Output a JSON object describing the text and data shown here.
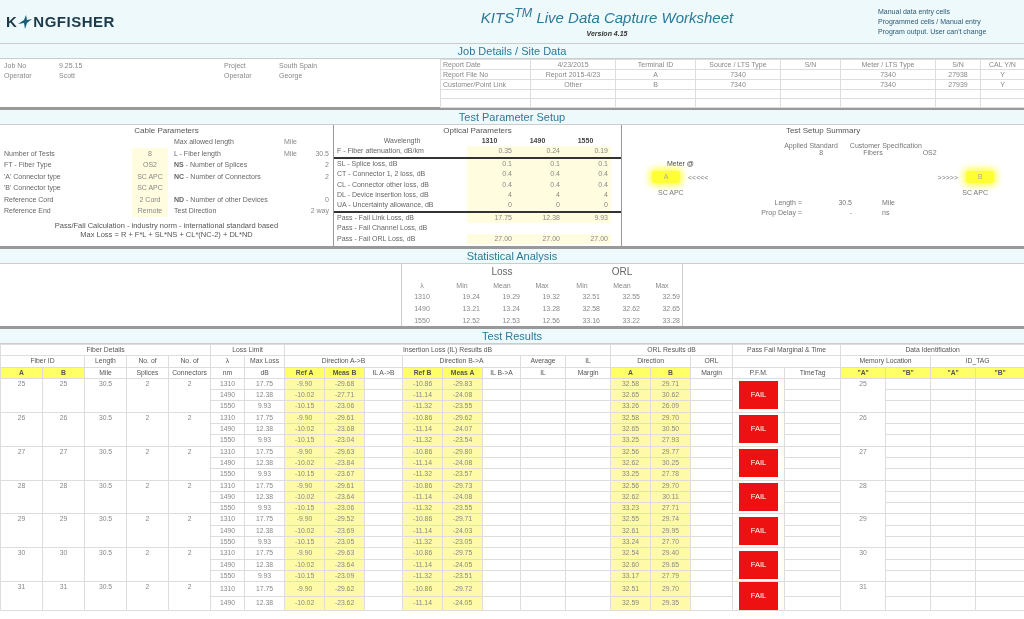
{
  "header": {
    "logo": {
      "before": "K",
      "after": "NGFISHER"
    },
    "title": "KITS$^{TM}$ Live Data Capture Worksheet",
    "version": "Version 4.15",
    "legend": [
      "Manual data entry cells",
      "Programmed cells / Manual entry",
      "Program output. User can't change"
    ]
  },
  "job_details": {
    "title": "Job Details / Site Data",
    "left_fields": [
      [
        {
          "label": "Job No",
          "value": "9.25.15"
        },
        {
          "label": "Operator",
          "value": "Scott"
        }
      ],
      [
        {
          "label": "Project",
          "value": "South Spain"
        },
        {
          "label": "Operator",
          "value": "George"
        }
      ]
    ],
    "report_fields": [
      {
        "label": "Report Date",
        "value": "4/23/2015"
      },
      {
        "label": "Report File No",
        "value": "Report 2015-4/23"
      },
      {
        "label": "Customer/Point Link",
        "value": "Other"
      }
    ],
    "equipment_columns": [
      "Terminal ID",
      "Source / LTS Type",
      "S/N",
      "Meter / LTS Type",
      "S/N",
      "CAL Y/N"
    ],
    "equipment_rows": [
      [
        "A",
        "7340",
        "",
        "7340",
        "27938",
        "Y"
      ],
      [
        "B",
        "7340",
        "",
        "7340",
        "27939",
        "Y"
      ]
    ]
  },
  "test_parameter_setup": {
    "title": "Test Parameter Setup",
    "cable": {
      "title": "Cable Parameters",
      "rows": [
        [
          "",
          "",
          "Max allowed length",
          "Mile",
          ""
        ],
        [
          "Number of Tests",
          "8",
          "L - Fiber length",
          "Mile",
          "30.5"
        ],
        [
          "FT - Fiber Type",
          "OS2",
          "**NS** - Number of Splices",
          "",
          "2"
        ],
        [
          "'A' Connector type",
          "SC APC",
          "**NC** - Number of Connectors",
          "",
          "2"
        ],
        [
          "'B' Connector type",
          "SC APC",
          "",
          "",
          ""
        ],
        [
          "Reference Cord",
          "2 Cord",
          "**ND** - Number of other Devices",
          "",
          "0"
        ],
        [
          "Reference End",
          "Remote",
          "Test Direction",
          "",
          "2 way"
        ]
      ],
      "calculation": [
        "Pass/Fail Calculation - industry norm - international standard based",
        "Max Loss = R + F*L + SL*NS + CL*(NC-2) + DL*ND"
      ]
    },
    "optical": {
      "title": "Optical Parameters",
      "header": [
        "Wavelength",
        "1310",
        "1490",
        "1550"
      ],
      "rows": [
        [
          "F - Fiber attenuation, dB/km",
          "0.35",
          "0.24",
          "0.19"
        ],
        [
          "SL - Splice loss, dB",
          "0.1",
          "0.1",
          "0.1"
        ],
        [
          "CT - Connector 1, 2 loss, dB",
          "0.4",
          "0.4",
          "0.4"
        ],
        [
          "CL - Connector other loss, dB",
          "0.4",
          "0.4",
          "0.4"
        ],
        [
          "DL - Device insertion loss, dB",
          "4",
          "4",
          "4"
        ],
        [
          "UA - Uncertainty allowance, dB",
          "0",
          "0",
          "0"
        ],
        [
          "Pass - Fail Link Loss, dB",
          "17.75",
          "12.38",
          "9.93"
        ],
        [
          "Pass - Fail Channel Loss, dB",
          "",
          "",
          ""
        ],
        [
          "Pass - Fail ORL Loss, dB",
          "27.00",
          "27.00",
          "27.00"
        ]
      ]
    },
    "summary": {
      "title": "Test Setup Summary",
      "standard_label": "Applied Standard",
      "spec_label": "Customer Specification",
      "fiber_count": "8",
      "fibers_label": "Fibers",
      "fiber_type": "OS2",
      "meter_label": "Meter @",
      "end_a": {
        "label": "A",
        "arrows": "<<<<<",
        "connector": "SC APC"
      },
      "end_b": {
        "label": "B",
        "arrows": ">>>>>",
        "connector": "SC APC"
      },
      "metrics": [
        {
          "label": "Length =",
          "value": "30.5",
          "unit": "Mile"
        },
        {
          "label": "Prop Delay =",
          "value": "-",
          "unit": "ns"
        }
      ]
    }
  },
  "statistical_analysis": {
    "title": "Statistical Analysis",
    "groups": [
      "Loss",
      "ORL"
    ],
    "columns": [
      "λ",
      "Min",
      "Mean",
      "Max",
      "Min",
      "Mean",
      "Max"
    ],
    "rows": [
      [
        "1310",
        "19.24",
        "19.29",
        "19.32",
        "32.51",
        "32.55",
        "32.59"
      ],
      [
        "1490",
        "13.21",
        "13.24",
        "13.28",
        "32.58",
        "32.62",
        "32.65"
      ],
      [
        "1550",
        "12.52",
        "12.53",
        "12.56",
        "33.16",
        "33.22",
        "33.28"
      ]
    ]
  },
  "test_results": {
    "title": "Test Results",
    "header_rows": [
      [
        {
          "text": "Fiber Details"
        },
        {
          "text": "Loss Limit"
        },
        {
          "text": "Insertion Loss (IL) Results dB"
        },
        {
          "text": "ORL Results dB"
        },
        {
          "text": "Pass Fail Marginal & Time"
        },
        {
          "text": "Data Identification"
        }
      ],
      [
        {
          "text": "Fiber ID"
        },
        {
          "text": "Length"
        },
        {
          "text": "No. of"
        },
        {
          "text": "No. of"
        },
        {
          "text": "λ"
        },
        {
          "text": "Max Loss"
        },
        {
          "text": "Direction A->B"
        },
        {
          "text": "Direction B->A"
        },
        {
          "text": "Average"
        },
        {
          "text": "IL"
        },
        {
          "text": "Direction"
        },
        {
          "text": "ORL"
        },
        {
          "text": ""
        },
        {
          "text": "Memory Location"
        },
        {
          "text": "ID_TAG"
        }
      ],
      [
        {
          "text": "A",
          "highlight": true
        },
        {
          "text": "B",
          "highlight": true
        },
        {
          "text": "Mile",
          "highlight": false
        },
        {
          "text": "Splices",
          "highlight": false
        },
        {
          "text": "Connectors",
          "highlight": false
        },
        {
          "text": "nm",
          "highlight": false
        },
        {
          "text": "dB",
          "highlight": false
        },
        {
          "text": "Ref A",
          "highlight": true
        },
        {
          "text": "Meas B",
          "highlight": true
        },
        {
          "text": "IL A->B",
          "highlight": false
        },
        {
          "text": "Ref B",
          "highlight": true
        },
        {
          "text": "Meas A",
          "highlight": true
        },
        {
          "text": "IL B->A",
          "highlight": false
        },
        {
          "text": "IL",
          "highlight": false
        },
        {
          "text": "Margin",
          "highlight": false
        },
        {
          "text": "A",
          "highlight": true
        },
        {
          "text": "B",
          "highlight": true
        },
        {
          "text": "Margin",
          "highlight": false
        },
        {
          "text": "P.F.M.",
          "highlight": false
        },
        {
          "text": "TimeTag",
          "highlight": false
        },
        {
          "text": "\"A\"",
          "highlight": true
        },
        {
          "text": "\"B\"",
          "highlight": true
        },
        {
          "text": "\"A\"",
          "highlight": true
        },
        {
          "text": "\"B\"",
          "highlight": true
        }
      ]
    ],
    "groups": [
      {
        "fiber_a": "25",
        "fiber_b": "25",
        "length": "30.5",
        "splices": "2",
        "connectors": "2",
        "memory_a": "25",
        "status": "FAIL",
        "pass": false,
        "rows": [
          {
            "wavelength": "1310",
            "max_loss": "17.75",
            "ref_a": "-9.90",
            "meas_b": "-29.68",
            "ref_b": "-10.86",
            "meas_a": "-29.83",
            "orl_a": "32.58",
            "orl_b": "29.71"
          },
          {
            "wavelength": "1490",
            "max_loss": "12.38",
            "ref_a": "-10.02",
            "meas_b": "-27.71",
            "ref_b": "-11.14",
            "meas_a": "-24.08",
            "orl_a": "32.65",
            "orl_b": "30.62"
          },
          {
            "wavelength": "1550",
            "max_loss": "9.93",
            "ref_a": "-10.15",
            "meas_b": "-23.06",
            "ref_b": "-11.32",
            "meas_a": "-23.55",
            "orl_a": "33.26",
            "orl_b": "26.09"
          }
        ]
      },
      {
        "fiber_a": "26",
        "fiber_b": "26",
        "length": "30.5",
        "splices": "2",
        "connectors": "2",
        "memory_a": "26",
        "status": "FAIL",
        "pass": false,
        "rows": [
          {
            "wavelength": "1310",
            "max_loss": "17.75",
            "ref_a": "-9.90",
            "meas_b": "-29.61",
            "ref_b": "-10.86",
            "meas_a": "-29.62",
            "orl_a": "32.58",
            "orl_b": "29.70"
          },
          {
            "wavelength": "1490",
            "max_loss": "12.38",
            "ref_a": "-10.02",
            "meas_b": "-23.68",
            "ref_b": "-11.14",
            "meas_a": "-24.07",
            "orl_a": "32.65",
            "orl_b": "30.50"
          },
          {
            "wavelength": "1550",
            "max_loss": "9.93",
            "ref_a": "-10.15",
            "meas_b": "-23.04",
            "ref_b": "-11.32",
            "meas_a": "-23.54",
            "orl_a": "33.25",
            "orl_b": "27.93"
          }
        ]
      },
      {
        "fiber_a": "27",
        "fiber_b": "27",
        "length": "30.5",
        "splices": "2",
        "connectors": "2",
        "memory_a": "27",
        "status": "FAIL",
        "pass": false,
        "rows": [
          {
            "wavelength": "1310",
            "max_loss": "17.75",
            "ref_a": "-9.90",
            "meas_b": "-29.63",
            "ref_b": "-10.86",
            "meas_a": "-29.80",
            "orl_a": "32.56",
            "orl_b": "29.77"
          },
          {
            "wavelength": "1490",
            "max_loss": "12.38",
            "ref_a": "-10.02",
            "meas_b": "-23.84",
            "ref_b": "-11.14",
            "meas_a": "-24.08",
            "orl_a": "32.62",
            "orl_b": "30.25"
          },
          {
            "wavelength": "1550",
            "max_loss": "9.93",
            "ref_a": "-10.15",
            "meas_b": "-23.67",
            "ref_b": "-11.32",
            "meas_a": "-23.57",
            "orl_a": "33.25",
            "orl_b": "27.78"
          }
        ]
      },
      {
        "fiber_a": "28",
        "fiber_b": "28",
        "length": "30.5",
        "splices": "2",
        "connectors": "2",
        "memory_a": "28",
        "status": "FAIL",
        "pass": false,
        "rows": [
          {
            "wavelength": "1310",
            "max_loss": "17.75",
            "ref_a": "-9.90",
            "meas_b": "-29.61",
            "ref_b": "-10.86",
            "meas_a": "-29.73",
            "orl_a": "32.56",
            "orl_b": "29.70"
          },
          {
            "wavelength": "1490",
            "max_loss": "12.38",
            "ref_a": "-10.02",
            "meas_b": "-23.64",
            "ref_b": "-11.14",
            "meas_a": "-24.08",
            "orl_a": "32.62",
            "orl_b": "30.11"
          },
          {
            "wavelength": "1550",
            "max_loss": "9.93",
            "ref_a": "-10.15",
            "meas_b": "-23.06",
            "ref_b": "-11.32",
            "meas_a": "-23.55",
            "orl_a": "33.23",
            "orl_b": "27.71"
          }
        ]
      },
      {
        "fiber_a": "29",
        "fiber_b": "29",
        "length": "30.5",
        "splices": "2",
        "connectors": "2",
        "memory_a": "29",
        "status": "FAIL",
        "pass": false,
        "rows": [
          {
            "wavelength": "1310",
            "max_loss": "17.75",
            "ref_a": "-9.90",
            "meas_b": "-29.52",
            "ref_b": "-10.86",
            "meas_a": "-29.71",
            "orl_a": "32.55",
            "orl_b": "29.74"
          },
          {
            "wavelength": "1490",
            "max_loss": "12.38",
            "ref_a": "-10.02",
            "meas_b": "-23.69",
            "ref_b": "-11.14",
            "meas_a": "-24.03",
            "orl_a": "32.61",
            "orl_b": "29.95"
          },
          {
            "wavelength": "1550",
            "max_loss": "9.93",
            "ref_a": "-10.15",
            "meas_b": "-23.05",
            "ref_b": "-11.32",
            "meas_a": "-23.05",
            "orl_a": "33.24",
            "orl_b": "27.70"
          }
        ]
      },
      {
        "fiber_a": "30",
        "fiber_b": "30",
        "length": "30.5",
        "splices": "2",
        "connectors": "2",
        "memory_a": "30",
        "status": "FAIL",
        "pass": false,
        "rows": [
          {
            "wavelength": "1310",
            "max_loss": "17.75",
            "ref_a": "-9.90",
            "meas_b": "-29.63",
            "ref_b": "-10.86",
            "meas_a": "-29.75",
            "orl_a": "32.54",
            "orl_b": "29.40"
          },
          {
            "wavelength": "1490",
            "max_loss": "12.38",
            "ref_a": "-10.02",
            "meas_b": "-23.64",
            "ref_b": "-11.14",
            "meas_a": "-24.05",
            "orl_a": "32.60",
            "orl_b": "29.65"
          },
          {
            "wavelength": "1550",
            "max_loss": "9.93",
            "ref_a": "-10.15",
            "meas_b": "-23.09",
            "ref_b": "-11.32",
            "meas_a": "-23.51",
            "orl_a": "33.17",
            "orl_b": "27.79"
          }
        ]
      },
      {
        "fiber_a": "31",
        "fiber_b": "31",
        "length": "30.5",
        "splices": "2",
        "connectors": "2",
        "memory_a": "31",
        "status": "FAIL",
        "pass": false,
        "rows": [
          {
            "wavelength": "1310",
            "max_loss": "17.75",
            "ref_a": "-9.90",
            "meas_b": "-29.62",
            "ref_b": "-10.86",
            "meas_a": "-29.72",
            "orl_a": "32.51",
            "orl_b": "29.70"
          },
          {
            "wavelength": "1490",
            "max_loss": "12.38",
            "ref_a": "-10.02",
            "meas_b": "-23.62",
            "ref_b": "-11.14",
            "meas_a": "-24.05",
            "orl_a": "32.59",
            "orl_b": "29.35"
          }
        ]
      }
    ]
  }
}
